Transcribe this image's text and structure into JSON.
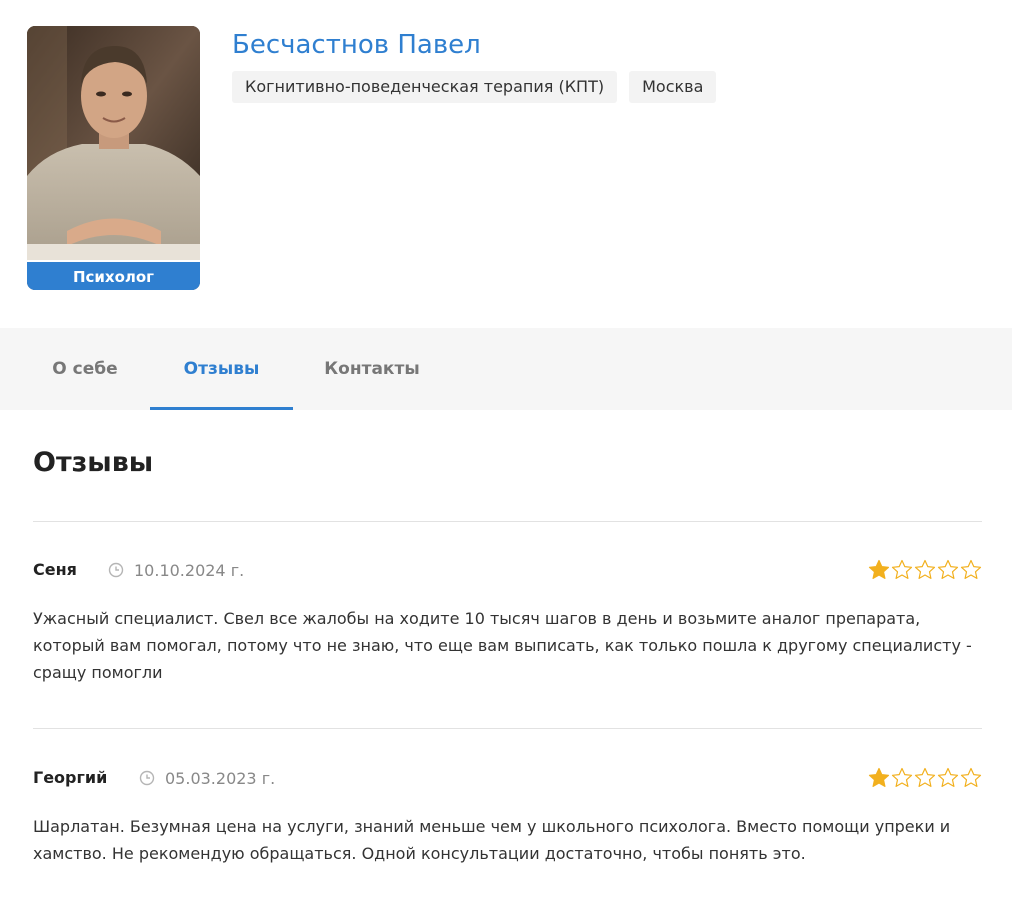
{
  "profile": {
    "name": "Бесчастнов Павел",
    "role": "Психолог",
    "tags": [
      "Когнитивно-поведенческая терапия (КПТ)",
      "Москва"
    ]
  },
  "tabs": [
    {
      "label": "О себе",
      "active": false
    },
    {
      "label": "Отзывы",
      "active": true
    },
    {
      "label": "Контакты",
      "active": false
    }
  ],
  "reviews_section": {
    "title": "Отзывы",
    "items": [
      {
        "author": "Сеня",
        "date": "10.10.2024 г.",
        "rating": 1,
        "max_rating": 5,
        "text": "Ужасный специалист. Свел все жалобы на ходите 10 тысяч шагов в день и возьмите аналог препарата, который вам помогал, потому что не знаю, что еще вам выписать, как только пошла к другому специалисту - сращу помогли"
      },
      {
        "author": "Георгий",
        "date": "05.03.2023 г.",
        "rating": 1,
        "max_rating": 5,
        "text": "Шарлатан. Безумная цена на услуги, знаний меньше чем у школьного психолога. Вместо помощи упреки и хамство. Не рекомендую обращаться. Одной консультации достаточно, чтобы понять это."
      }
    ]
  },
  "colors": {
    "accent": "#2f7fd0",
    "star_filled": "#f2b01e",
    "star_empty_stroke": "#f2b01e"
  }
}
